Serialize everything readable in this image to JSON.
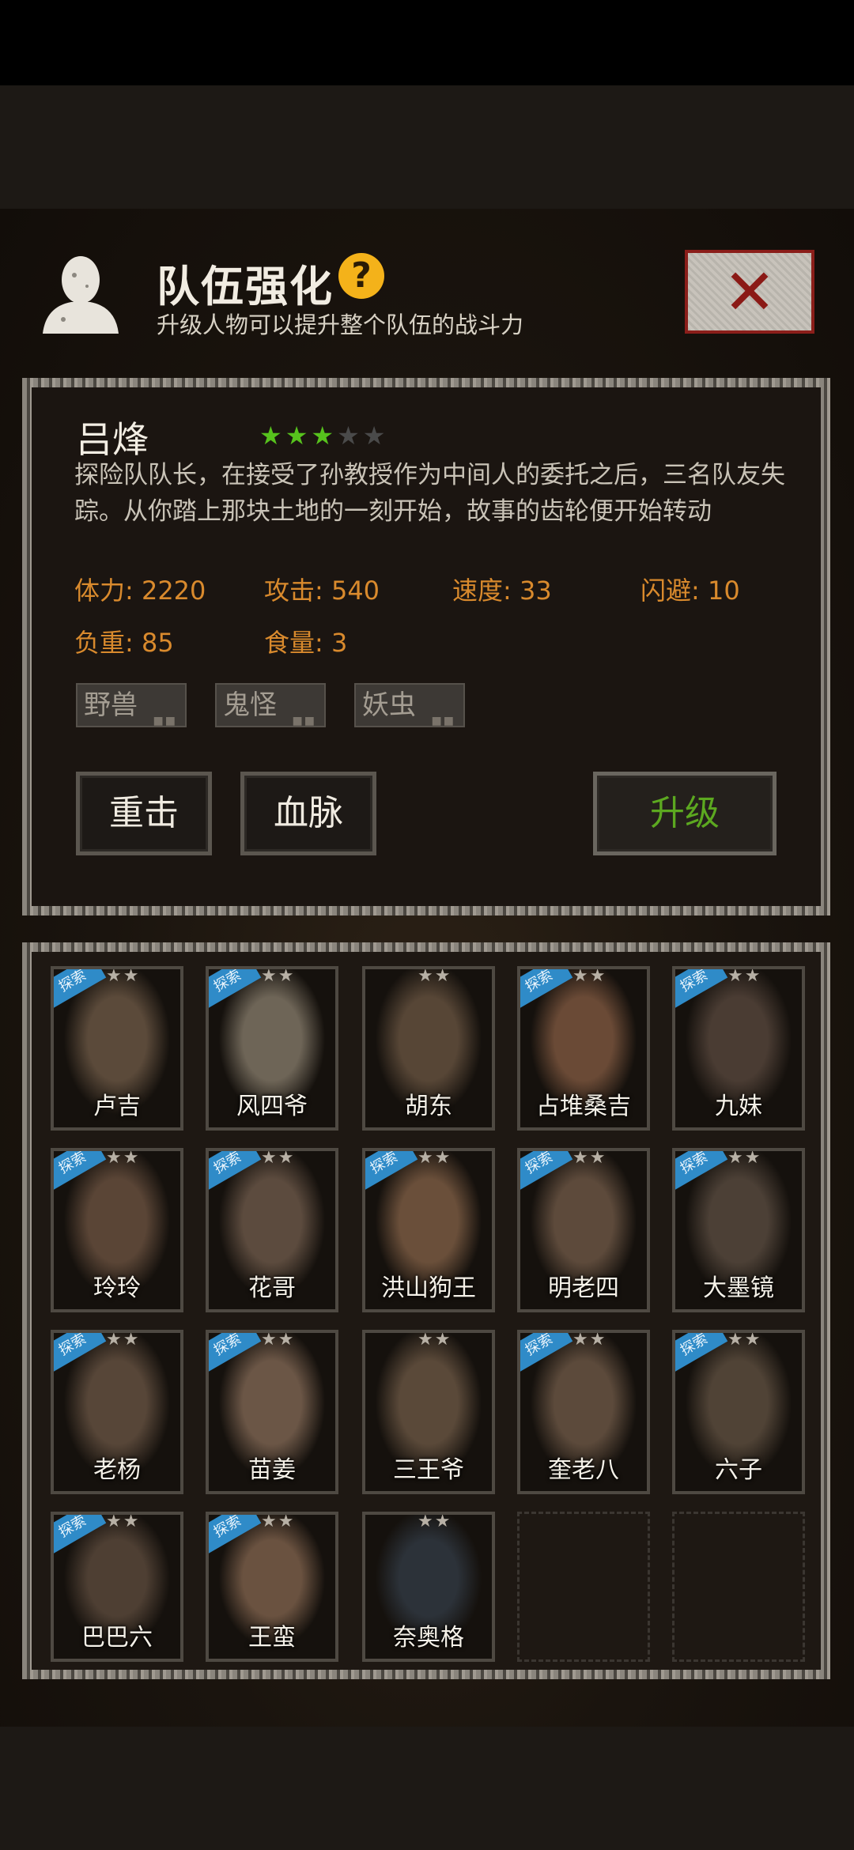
{
  "header": {
    "title": "队伍强化",
    "help_symbol": "?",
    "subtitle": "升级人物可以提升整个队伍的战斗力",
    "close_symbol": "✕"
  },
  "hero": {
    "name": "吕烽",
    "stars_on": 3,
    "stars_total": 5,
    "description": "探险队队长，在接受了孙教授作为中间人的委托之后，三名队友失踪。从你踏上那块土地的一刻开始，故事的齿轮便开始转动",
    "stats": {
      "hp": "体力: 2220",
      "attack": "攻击: 540",
      "speed": "速度: 33",
      "dodge": "闪避: 10",
      "load": "负重: 85",
      "food": "食量: 3"
    },
    "tags": [
      "野兽",
      "鬼怪",
      "妖虫"
    ],
    "buttons": {
      "heavy_strike": "重击",
      "bloodline": "血脉",
      "upgrade": "升级"
    }
  },
  "roster": {
    "badge_label": "探索",
    "members": [
      {
        "name": "卢吉",
        "badge": true,
        "stars": "★★",
        "tone": "#5b4a3a"
      },
      {
        "name": "风四爷",
        "badge": true,
        "stars": "★★",
        "tone": "#6e6557"
      },
      {
        "name": "胡东",
        "badge": false,
        "stars": "★★",
        "tone": "#574636"
      },
      {
        "name": "占堆桑吉",
        "badge": true,
        "stars": "★★",
        "tone": "#6a4a36"
      },
      {
        "name": "九妹",
        "badge": true,
        "stars": "★★",
        "tone": "#4a3c33"
      },
      {
        "name": "玲玲",
        "badge": true,
        "stars": "★★",
        "tone": "#5a4536"
      },
      {
        "name": "花哥",
        "badge": true,
        "stars": "★★",
        "tone": "#5c4b3e"
      },
      {
        "name": "洪山狗王",
        "badge": true,
        "stars": "★★",
        "tone": "#6a4f3a"
      },
      {
        "name": "明老四",
        "badge": true,
        "stars": "★★",
        "tone": "#5d4a3b"
      },
      {
        "name": "大墨镜",
        "badge": true,
        "stars": "★★",
        "tone": "#4c4036"
      },
      {
        "name": "老杨",
        "badge": true,
        "stars": "★★",
        "tone": "#574638"
      },
      {
        "name": "苗姜",
        "badge": true,
        "stars": "★★",
        "tone": "#6b5646"
      },
      {
        "name": "三王爷",
        "badge": false,
        "stars": "★★",
        "tone": "#5a4939"
      },
      {
        "name": "奎老八",
        "badge": true,
        "stars": "★★",
        "tone": "#5c4a3b"
      },
      {
        "name": "六子",
        "badge": true,
        "stars": "★★",
        "tone": "#504336"
      },
      {
        "name": "巴巴六",
        "badge": true,
        "stars": "★★",
        "tone": "#4e3f33"
      },
      {
        "name": "王蛮",
        "badge": true,
        "stars": "★★",
        "tone": "#6a5240"
      },
      {
        "name": "奈奥格",
        "badge": false,
        "stars": "★★",
        "tone": "#2c3239"
      }
    ],
    "empty_slots": 2
  }
}
